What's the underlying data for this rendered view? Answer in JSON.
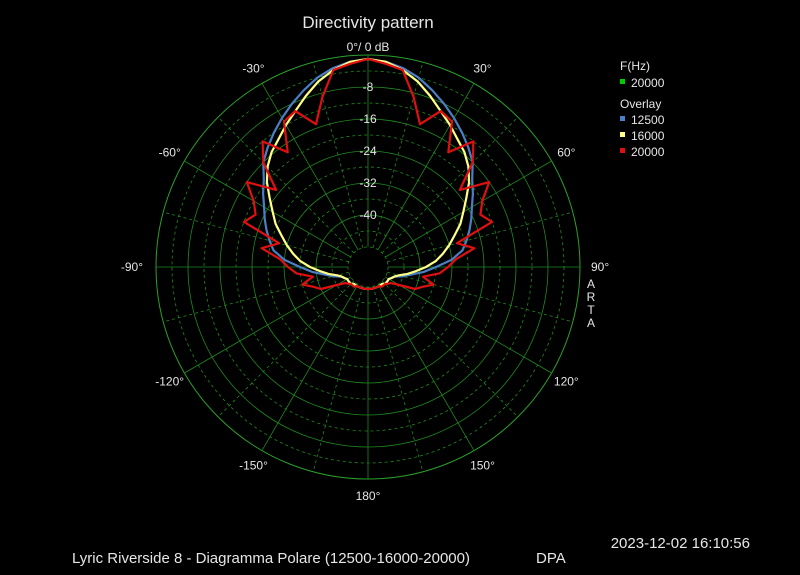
{
  "chart_data": {
    "type": "polar",
    "title": "Directivity pattern",
    "r_unit_label": "0°/ 0 dB",
    "r_ticks": [
      "-8",
      "-16",
      "-24",
      "-32",
      "-40"
    ],
    "r_range_db": [
      -48,
      0
    ],
    "angle_ticks": [
      "-30°",
      "30°",
      "-60°",
      "60°",
      "-90°",
      "90°",
      "-120°",
      "120°",
      "-150°",
      "150°",
      "180°"
    ],
    "side_label": "ARTA",
    "legend": {
      "freq_header": "F(Hz)",
      "freq_value": "20000",
      "freq_color": "#00cc00",
      "overlay_header": "Overlay"
    },
    "angles_deg": [
      0,
      5,
      10,
      15,
      20,
      25,
      30,
      35,
      40,
      45,
      50,
      55,
      60,
      65,
      70,
      75,
      80,
      85,
      90,
      95,
      100,
      105,
      110,
      115,
      120,
      125,
      130,
      135,
      140,
      145,
      150,
      155,
      160,
      165,
      170,
      175,
      180
    ],
    "series": [
      {
        "name": "12500",
        "color": "#4a7fc4",
        "values": [
          -1,
          -1.5,
          -2.5,
          -4,
          -6,
          -8,
          -10,
          -12,
          -14,
          -16,
          -19,
          -21,
          -23,
          -24.5,
          -26,
          -27.5,
          -29,
          -32,
          -36,
          -39,
          -42,
          -44,
          -46,
          -46.5,
          -47,
          -47,
          -47,
          -47,
          -47.5,
          -47.5,
          -47.5,
          -47.5,
          -47.5,
          -47.5,
          -47.5,
          -47.5,
          -47.5
        ]
      },
      {
        "name": "16000",
        "color": "#ffff88",
        "values": [
          -1,
          -1.5,
          -3,
          -5,
          -7.5,
          -10,
          -12,
          -14,
          -15.5,
          -17.5,
          -20,
          -23,
          -25.5,
          -27.5,
          -30,
          -32,
          -34,
          -36,
          -38.5,
          -41,
          -43,
          -45,
          -46,
          -46.5,
          -47,
          -47,
          -47,
          -47,
          -47.5,
          -47.5,
          -47.5,
          -47.5,
          -47.5,
          -47.5,
          -47.5,
          -47.5,
          -47.5
        ]
      },
      {
        "name": "20000",
        "color": "#e01010",
        "values": [
          -1,
          -2,
          -3,
          -9,
          -15,
          -10,
          -11,
          -18,
          -12,
          -16,
          -23,
          -16,
          -20,
          -22,
          -20,
          -30,
          -26,
          -31,
          -33,
          -35,
          -39,
          -36,
          -38.5,
          -40,
          -44,
          -46,
          -46.5,
          -47,
          -47,
          -47,
          -47.5,
          -47.5,
          -47.5,
          -47.5,
          -47.5,
          -47.5,
          -47.5
        ]
      }
    ]
  },
  "footer": {
    "timestamp": "2023-12-02  16:10:56",
    "caption": "Lyric Riverside 8 - Diagramma Polare (12500-16000-20000)",
    "method": "DPA"
  }
}
